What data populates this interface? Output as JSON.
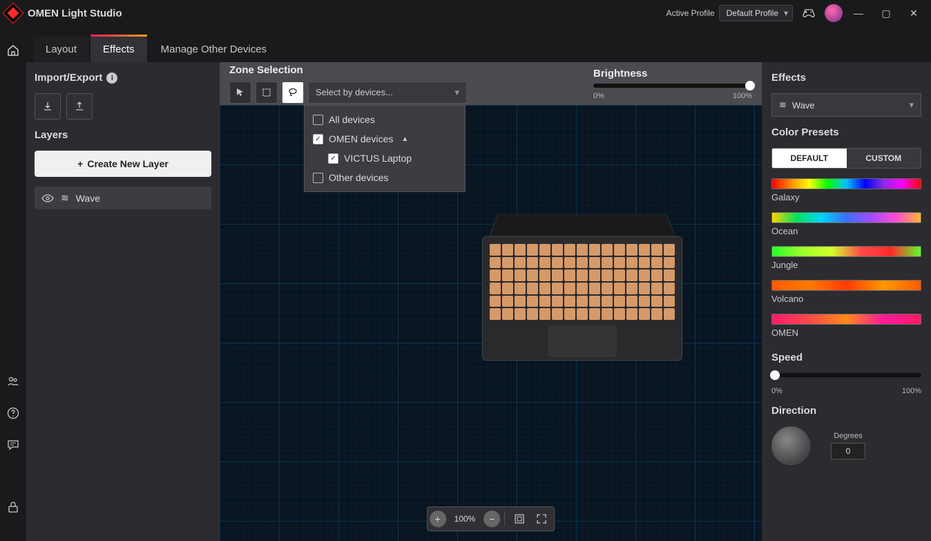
{
  "titlebar": {
    "app_title": "OMEN Light Studio",
    "active_profile_label": "Active Profile",
    "profile_value": "Default Profile"
  },
  "tabs": {
    "layout": "Layout",
    "effects": "Effects",
    "manage": "Manage Other Devices"
  },
  "left": {
    "import_export": "Import/Export",
    "layers": "Layers",
    "create_layer": "Create New Layer",
    "layer_items": [
      {
        "name": "Wave"
      }
    ]
  },
  "canvas": {
    "zone_selection": "Zone Selection",
    "select_by_devices": "Select by devices...",
    "brightness": "Brightness",
    "brightness_min": "0%",
    "brightness_max": "100%",
    "brightness_value": 100,
    "zoom": "100%",
    "dropdown": {
      "all": "All devices",
      "omen": "OMEN devices",
      "victus": "VICTUS Laptop",
      "other": "Other devices"
    }
  },
  "right": {
    "effects": "Effects",
    "effect_value": "Wave",
    "color_presets": "Color Presets",
    "preset_default": "DEFAULT",
    "preset_custom": "CUSTOM",
    "presets": {
      "galaxy": "Galaxy",
      "ocean": "Ocean",
      "jungle": "Jungle",
      "volcano": "Volcano",
      "omen": "OMEN"
    },
    "speed": "Speed",
    "speed_min": "0%",
    "speed_max": "100%",
    "speed_value": 0,
    "direction": "Direction",
    "degrees_label": "Degrees",
    "degrees_value": "0"
  }
}
